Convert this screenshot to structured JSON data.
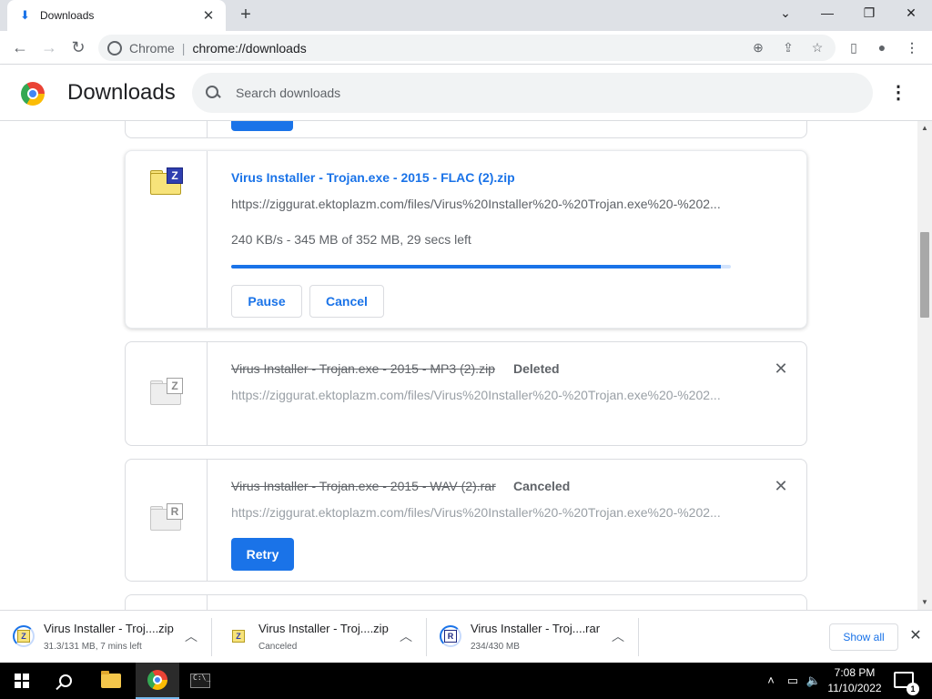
{
  "browser": {
    "tab_title": "Downloads",
    "new_tab_glyph": "+",
    "close_glyph": "✕",
    "omnibox_site_label": "Chrome",
    "omnibox_url": "chrome://downloads"
  },
  "page": {
    "title": "Downloads",
    "search_placeholder": "Search downloads"
  },
  "downloads": [
    {
      "file_name": "Virus Installer - Trojan.exe - 2015 - FLAC (2).zip",
      "url": "https://ziggurat.ektoplazm.com/files/Virus%20Installer%20-%20Trojan.exe%20-%202...",
      "progress_text": "240 KB/s - 345 MB of 352 MB, 29 secs left",
      "progress_fraction": 0.98,
      "icon_letter": "Z",
      "pause_label": "Pause",
      "cancel_label": "Cancel"
    },
    {
      "file_name": "Virus Installer - Trojan.exe - 2015 - MP3 (2).zip",
      "status": "Deleted",
      "url": "https://ziggurat.ektoplazm.com/files/Virus%20Installer%20-%20Trojan.exe%20-%202...",
      "icon_letter": "Z"
    },
    {
      "file_name": "Virus Installer - Trojan.exe - 2015 - WAV (2).rar",
      "status": "Canceled",
      "url": "https://ziggurat.ektoplazm.com/files/Virus%20Installer%20-%20Trojan.exe%20-%202...",
      "icon_letter": "R",
      "retry_label": "Retry"
    }
  ],
  "shelf": {
    "items": [
      {
        "name": "Virus Installer - Troj....zip",
        "sub": "31.3/131 MB, 7 mins left",
        "icon_letter": "Z"
      },
      {
        "name": "Virus Installer - Troj....zip",
        "sub": "Canceled",
        "icon_letter": "Z"
      },
      {
        "name": "Virus Installer - Troj....rar",
        "sub": "234/430 MB",
        "icon_letter": "R"
      }
    ],
    "show_all_label": "Show all"
  },
  "taskbar": {
    "time": "7:08 PM",
    "date": "11/10/2022",
    "notification_count": "1",
    "terminal_glyph": "C:\\_"
  },
  "colors": {
    "accent": "#1a73e8",
    "tabstrip": "#dee1e6"
  }
}
